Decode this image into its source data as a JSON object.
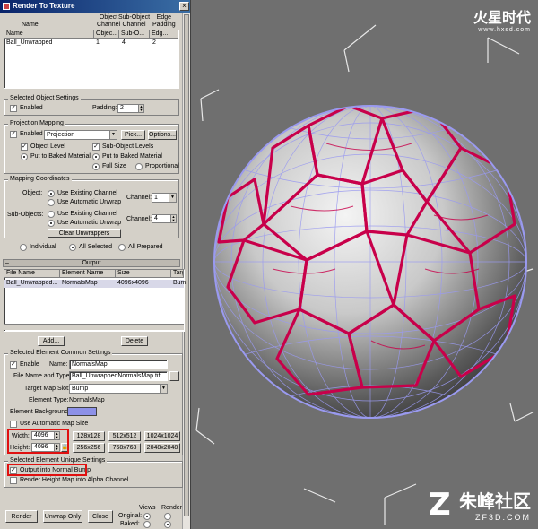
{
  "dialog": {
    "title": "Render To Texture",
    "close_glyph": "×",
    "objects_table": {
      "top_headers": [
        "Name",
        "Object\nChannel",
        "Sub-Object\nChannel",
        "Edge\nPadding"
      ],
      "sub_headers": [
        "Name",
        "Objec...",
        "Sub-O...",
        "Edg..."
      ],
      "rows": [
        {
          "name": "Ball_Unwrapped",
          "object_channel": "1",
          "subobject_channel": "4",
          "edge_padding": "2"
        }
      ]
    },
    "selected_object_settings": {
      "title": "Selected Object Settings",
      "enabled_label": "Enabled",
      "enabled": true,
      "padding_label": "Padding:",
      "padding_value": "2"
    },
    "projection_mapping": {
      "title": "Projection Mapping",
      "enabled_label": "Enabled",
      "enabled": true,
      "projection_value": "Projection",
      "pick_label": "Pick...",
      "options_label": "Options...",
      "object_level_label": "Object Level",
      "subobject_levels_label": "Sub-Object Levels",
      "put_to_baked_1": "Put to Baked Material",
      "put_to_baked_2": "Put to Baked Material",
      "full_size_label": "Full Size",
      "proportional_label": "Proportional"
    },
    "mapping_coordinates": {
      "title": "Mapping Coordinates",
      "object_label": "Object:",
      "use_existing_1": "Use Existing Channel",
      "use_auto_1": "Use Automatic Unwrap",
      "channel_label_1": "Channel:",
      "channel_value_1": "1",
      "subobjects_label": "Sub-Objects:",
      "use_existing_2": "Use Existing Channel",
      "use_auto_2": "Use Automatic Unwrap",
      "channel_label_2": "Channel:",
      "channel_value_2": "4",
      "clear_unwrappers_label": "Clear Unwrappers"
    },
    "selection_mode": {
      "individual_label": "Individual",
      "all_selected_label": "All Selected",
      "all_prepared_label": "All Prepared",
      "selected": "All Selected"
    },
    "output": {
      "rollout_title": "Output",
      "rollout_minus": "–",
      "headers": [
        "File Name",
        "Element Name",
        "Size",
        "Targ"
      ],
      "rows": [
        {
          "file_name": "Ball_Unwrapped...",
          "element_name": "NormalsMap",
          "size": "4096x4096",
          "target": "Bum"
        }
      ],
      "add_label": "Add...",
      "delete_label": "Delete"
    },
    "element_common": {
      "title": "Selected Element Common Settings",
      "enable_label": "Enable",
      "enable_checked": true,
      "name_label": "Name:",
      "name_value": "NormalsMap",
      "file_label": "File Name and Type:",
      "file_value": "Ball_UnwrappedNormalsMap.tif",
      "browse_label": "...",
      "target_slot_label": "Target Map Slot:",
      "target_slot_value": "Bump",
      "element_type_label": "Element Type:",
      "element_type_value": "NormalsMap",
      "element_background_label": "Element Background:",
      "background_color": "#8d91e8",
      "use_auto_map_size_label": "Use Automatic Map Size",
      "width_label": "Width:",
      "width_value": "4096",
      "height_label": "Height:",
      "height_value": "4096",
      "size_presets": [
        "128x128",
        "512x512",
        "1024x1024",
        "256x256",
        "768x768",
        "2048x2048"
      ]
    },
    "element_unique": {
      "title": "Selected Element Unique Settings",
      "output_normal_bump_label": "Output into Normal Bump",
      "output_normal_bump_checked": true,
      "render_height_label": "Render Height Map into Alpha Channel"
    },
    "bottom_bar": {
      "render_label": "Render",
      "unwrap_only_label": "Unwrap Only",
      "close_label": "Close",
      "original_label": "Original:",
      "baked_label": "Baked:",
      "views_label": "Views",
      "render_col_label": "Render"
    },
    "highlight_color": "#e01010"
  },
  "viewport": {
    "background_color": "#6f6f6f",
    "watermark_top": {
      "text": "火星时代",
      "url": "www.hxsd.com"
    },
    "watermark_bottom": {
      "text": "朱峰社区",
      "url": "ZF3D.COM",
      "mark": "Z"
    },
    "object_name": "soccer-ball-wireframe",
    "wire_color": "#c8004a",
    "mesh_color": "#9a9af0"
  }
}
